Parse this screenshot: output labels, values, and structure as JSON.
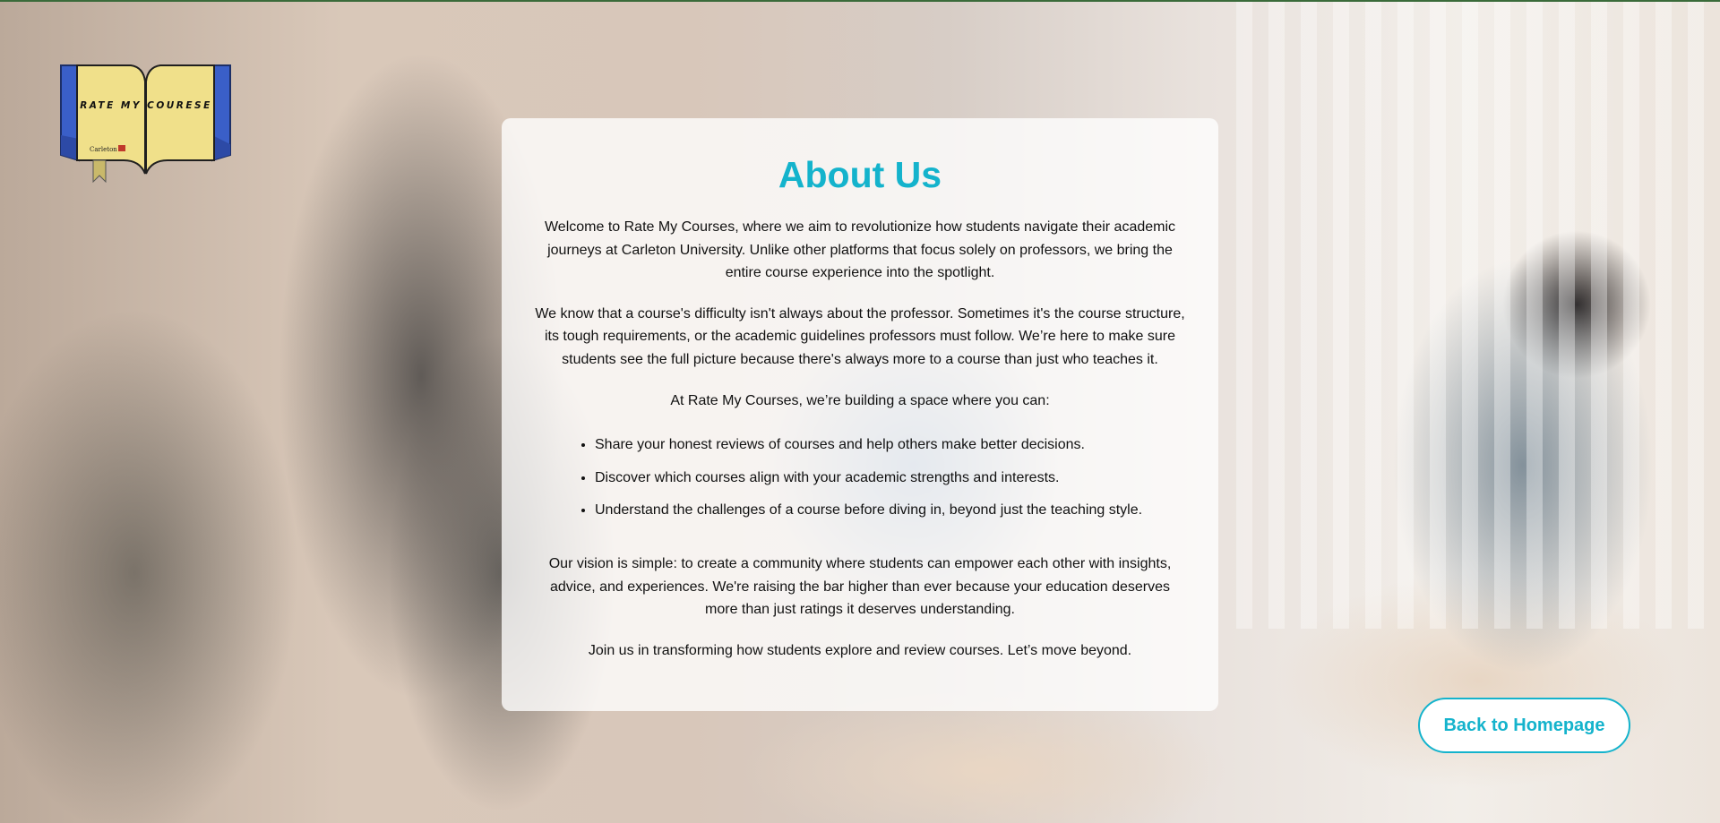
{
  "logo": {
    "title": "RATE MY COURESE",
    "university": "Carleton"
  },
  "about": {
    "heading": "About Us",
    "intro": "Welcome to Rate My Courses, where we aim to revolutionize how students navigate their academic journeys at Carleton University. Unlike other platforms that focus solely on professors, we bring the entire course experience into the spotlight.",
    "difficulty": "We know that a course's difficulty isn't always about the professor. Sometimes it's the course structure, its tough requirements, or the academic guidelines professors must follow. We’re here to make sure students see the full picture because there's always more to a course than just who teaches it.",
    "list_intro": "At Rate My Courses, we’re building a space where you can:",
    "bullets": [
      "Share your honest reviews of courses and help others make better decisions.",
      "Discover which courses align with your academic strengths and interests.",
      "Understand the challenges of a course before diving in, beyond just the teaching style."
    ],
    "vision": "Our vision is simple: to create a community where students can empower each other with insights, advice, and experiences. We're raising the bar higher than ever because your education deserves more than just ratings it deserves understanding.",
    "closing": "Join us in transforming how students explore and review courses. Let’s move beyond."
  },
  "back_button": {
    "label": "Back to Homepage"
  },
  "colors": {
    "accent": "#14b3cc",
    "logo_page": "#f0e08a",
    "logo_cover": "#3a5fc8"
  }
}
